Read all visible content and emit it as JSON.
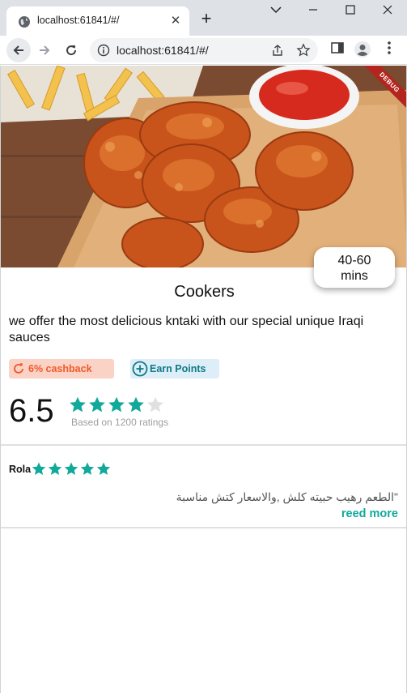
{
  "browser": {
    "tab_title": "localhost:61841/#/",
    "url": "localhost:61841/#/",
    "tab_close": "✕",
    "new_tab": "+",
    "window_controls": {
      "minimize": "─",
      "restore": "☐",
      "close": "✕"
    }
  },
  "app": {
    "debug_label": "DEBUG",
    "delivery_time": "40-60\nmins",
    "delivery_time_line1": "40-60",
    "delivery_time_line2": "mins",
    "restaurant_name": "Cookers",
    "description": "we offer the most delicious kntaki with our special unique Iraqi sauces",
    "badges": {
      "cashback": "6% cashback",
      "earn_points": "Earn Points"
    },
    "rating": {
      "score": "6.5",
      "stars": 4,
      "max_stars": 5,
      "note": "Based on 1200 ratings"
    },
    "review": {
      "reviewer": "Rola",
      "stars": 5,
      "text": "\"الطعم رهيب حبيته كلش ,والاسعار كتش مناسبة",
      "read_more": "reed more"
    }
  },
  "colors": {
    "accent": "#11a99a",
    "star_filled": "#11a99a",
    "star_empty": "#e0e0e0",
    "cashback_bg": "#fbd3c6",
    "cashback_text": "#ee5a2a",
    "earn_bg": "#deeef9",
    "earn_text": "#0e7a86"
  }
}
